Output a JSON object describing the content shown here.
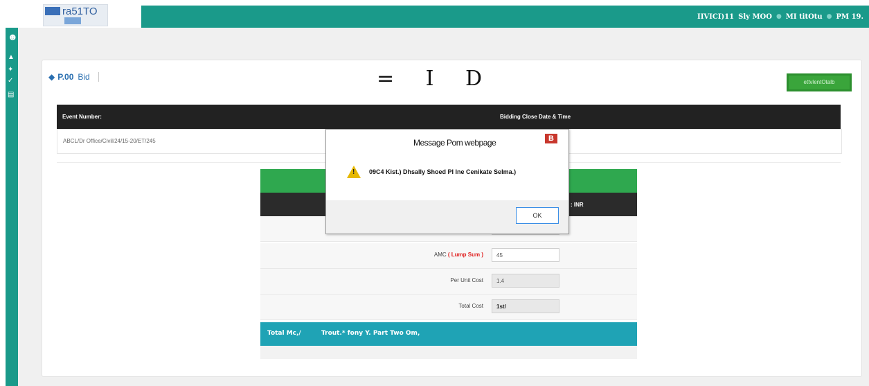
{
  "header": {
    "logo_text": "ra51TO",
    "nav": [
      "IIVICI)11",
      "Sly MOO",
      "MI titOtu",
      "PM 19."
    ]
  },
  "sidebar": {
    "icons": [
      "user-icon",
      "home-icon",
      "gavel-icon",
      "check-icon",
      "chart-icon"
    ]
  },
  "page": {
    "title_bold": "P.00",
    "title_rest": "Bid",
    "big_letters": "= I D",
    "green_button": "ettvlentOtalb"
  },
  "event_table": {
    "col1_header": "Event Number:",
    "col2_header": "Bidding Close Date & Time",
    "event_number": "ABCL/Dr Office/Civil/24/15-20/ET/245"
  },
  "form": {
    "currency_header": ": INR",
    "amc_label": "AMC",
    "amc_suffix": "( Lump Sum )",
    "amc_value": "45",
    "per_unit_label": "Per Unit Cost",
    "per_unit_value": "1.4",
    "total_cost_label": "Total Cost",
    "total_cost_value": "1st/",
    "footer_left": "Total Mc,/",
    "footer_right": "Trout.* fony Y. Part Two Om,"
  },
  "dialog": {
    "title": "Message Pom webpage",
    "close_label": "B",
    "message": "09C4 Kist.) Dhsally Shoed PI Ine Cenikate Selma.)",
    "ok_label": "OK"
  }
}
